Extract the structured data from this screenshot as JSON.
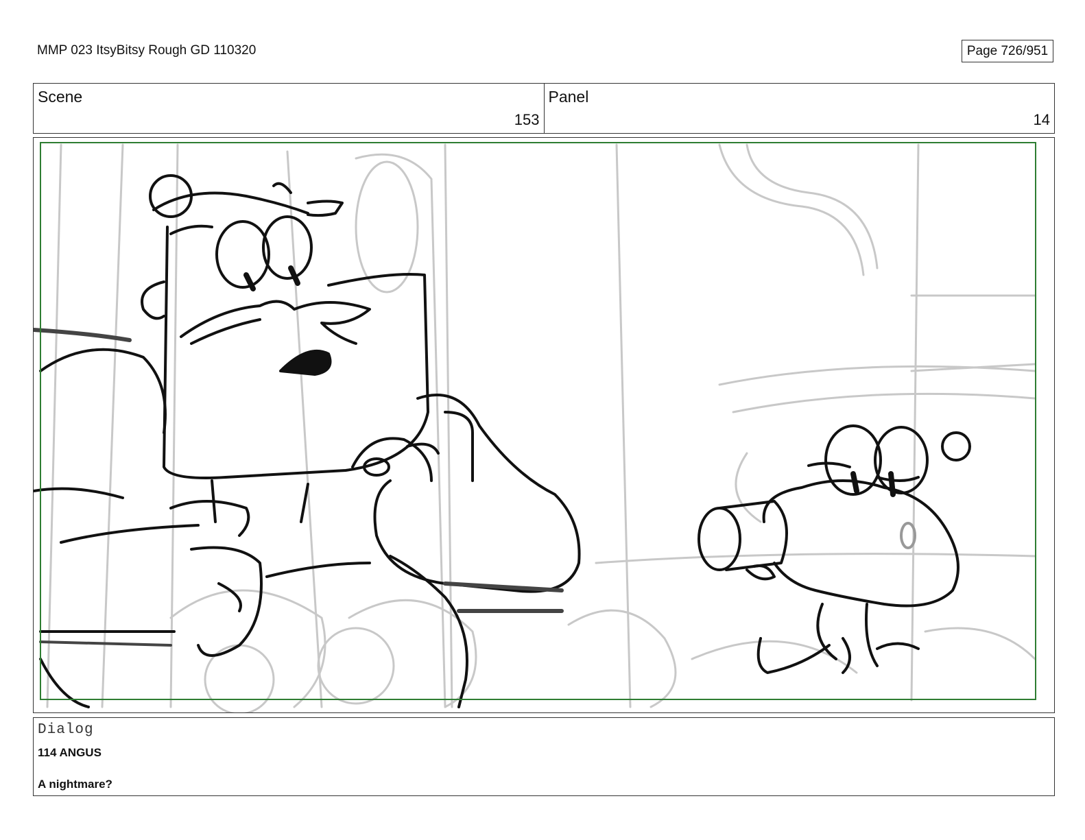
{
  "document": {
    "title": "MMP 023 ItsyBitsy Rough GD 110320",
    "page_label": "Page 726/951"
  },
  "header": {
    "scene_label": "Scene",
    "scene_value": "153",
    "panel_label": "Panel",
    "panel_value": "14"
  },
  "panel": {
    "frame_color": "#2e7d32",
    "ink_color": "#111111",
    "background_line_color": "#c8c8c8"
  },
  "dialog": {
    "label": "Dialog",
    "lines": [
      "114 ANGUS",
      "A nightmare?"
    ]
  }
}
